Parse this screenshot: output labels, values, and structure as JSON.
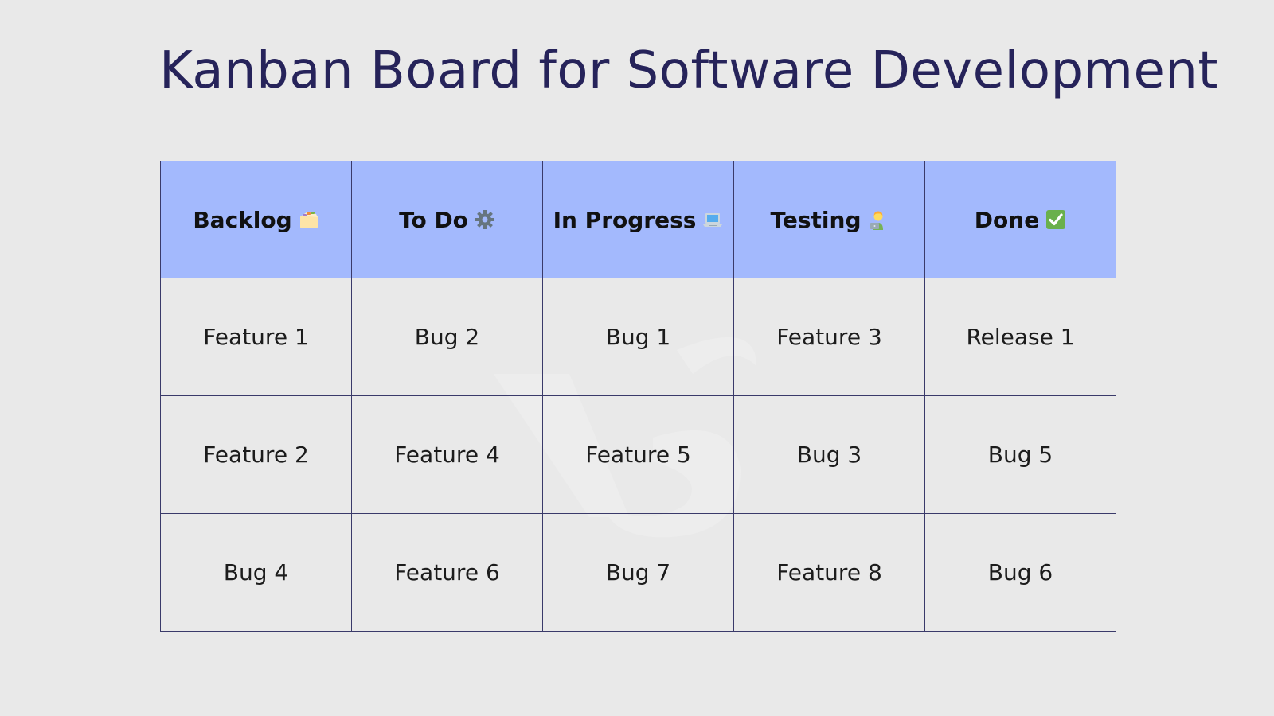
{
  "title": "Kanban Board for Software Development",
  "board": {
    "columns": [
      {
        "label": "Backlog",
        "icon": "card-index-dividers-icon"
      },
      {
        "label": "To Do",
        "icon": "gear-icon"
      },
      {
        "label": "In Progress",
        "icon": "laptop-icon"
      },
      {
        "label": "Testing",
        "icon": "technologist-icon"
      },
      {
        "label": "Done",
        "icon": "check-mark-button-icon"
      }
    ],
    "rows": [
      [
        "Feature 1",
        "Bug 2",
        "Bug 1",
        "Feature 3",
        "Release 1"
      ],
      [
        "Feature 2",
        "Feature 4",
        "Feature 5",
        "Bug 3",
        "Bug 5"
      ],
      [
        "Bug 4",
        "Feature 6",
        "Bug 7",
        "Feature 8",
        "Bug 6"
      ]
    ]
  },
  "colors": {
    "background": "#e9e9e9",
    "title": "#26235a",
    "header_fill": "#a3b9fd",
    "border": "#3a3a6a",
    "done_icon_green": "#6ab04c"
  }
}
